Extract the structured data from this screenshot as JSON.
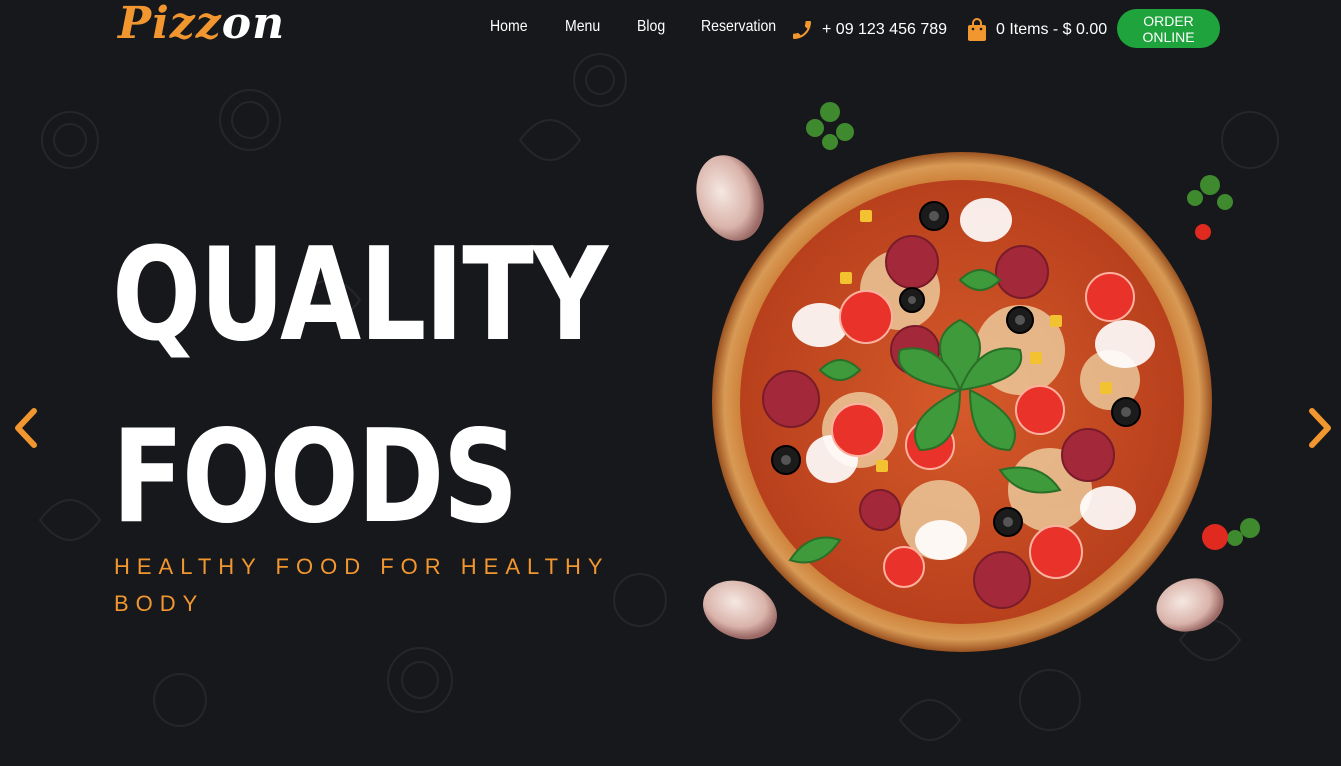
{
  "brand": {
    "logo_part1": "Pizz",
    "logo_part2": "on"
  },
  "nav": {
    "items": [
      "Home",
      "Menu",
      "Blog",
      "Reservation"
    ]
  },
  "header": {
    "phone": "+ 09 123 456 789",
    "cart": "0 Items - $ 0.00",
    "order_button": "ORDER ONLINE"
  },
  "hero": {
    "title_line1": "QUALITY",
    "title_line2": "FOODS",
    "subtitle": "HEALTHY FOOD FOR HEALTHY BODY"
  },
  "colors": {
    "accent": "#f29630",
    "button": "#1fa33c",
    "background": "#16181b"
  },
  "icons": {
    "phone": "phone-icon",
    "cart": "shopping-bag-icon",
    "prev": "chevron-left-icon",
    "next": "chevron-right-icon"
  }
}
